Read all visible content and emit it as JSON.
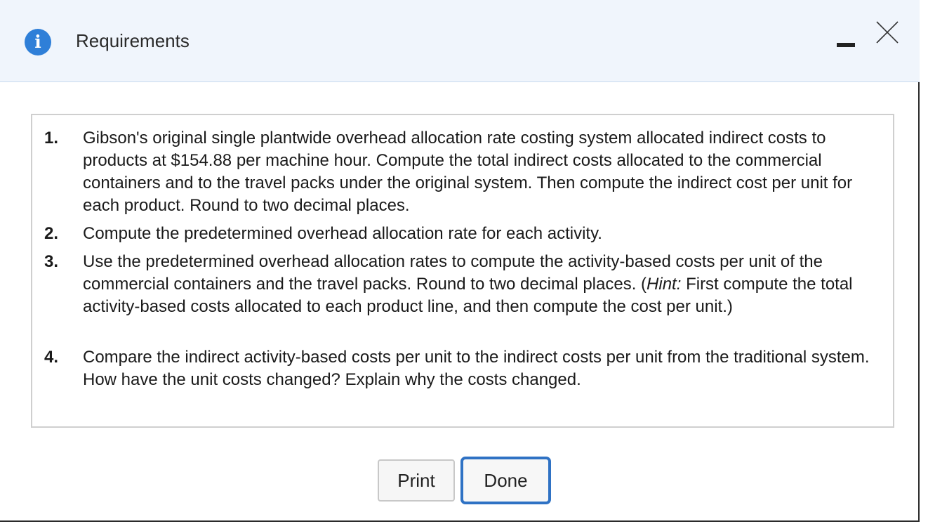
{
  "dialog": {
    "title": "Requirements",
    "info_icon": "info-icon",
    "minimize_icon": "minimize-icon",
    "close_icon": "close-icon"
  },
  "requirements": [
    {
      "num": "1.",
      "text": "Gibson's original single plantwide overhead allocation rate costing system allocated indirect costs to products at $154.88 per machine hour. Compute the total indirect costs allocated to the commercial containers and to the travel packs under the original system. Then compute the indirect cost per unit for each product. Round to two decimal places."
    },
    {
      "num": "2.",
      "text": "Compute the predetermined overhead allocation rate for each activity."
    },
    {
      "num": "3.",
      "text_before": "Use the predetermined overhead allocation rates to compute the activity-based costs per unit of the commercial containers and the travel packs. Round to two decimal places. (",
      "hint_label": "Hint:",
      "text_after": " First compute the total activity-based costs allocated to each product line, and then compute the cost per unit.)"
    },
    {
      "num": "4.",
      "text": "Compare the indirect activity-based costs per unit to the indirect costs per unit from the traditional system. How have the unit costs changed? Explain why the costs changed."
    }
  ],
  "buttons": {
    "print_label": "Print",
    "done_label": "Done"
  },
  "colors": {
    "header_bg": "#f0f5fc",
    "accent": "#2f72c4",
    "info_icon": "#2f7fd8"
  }
}
